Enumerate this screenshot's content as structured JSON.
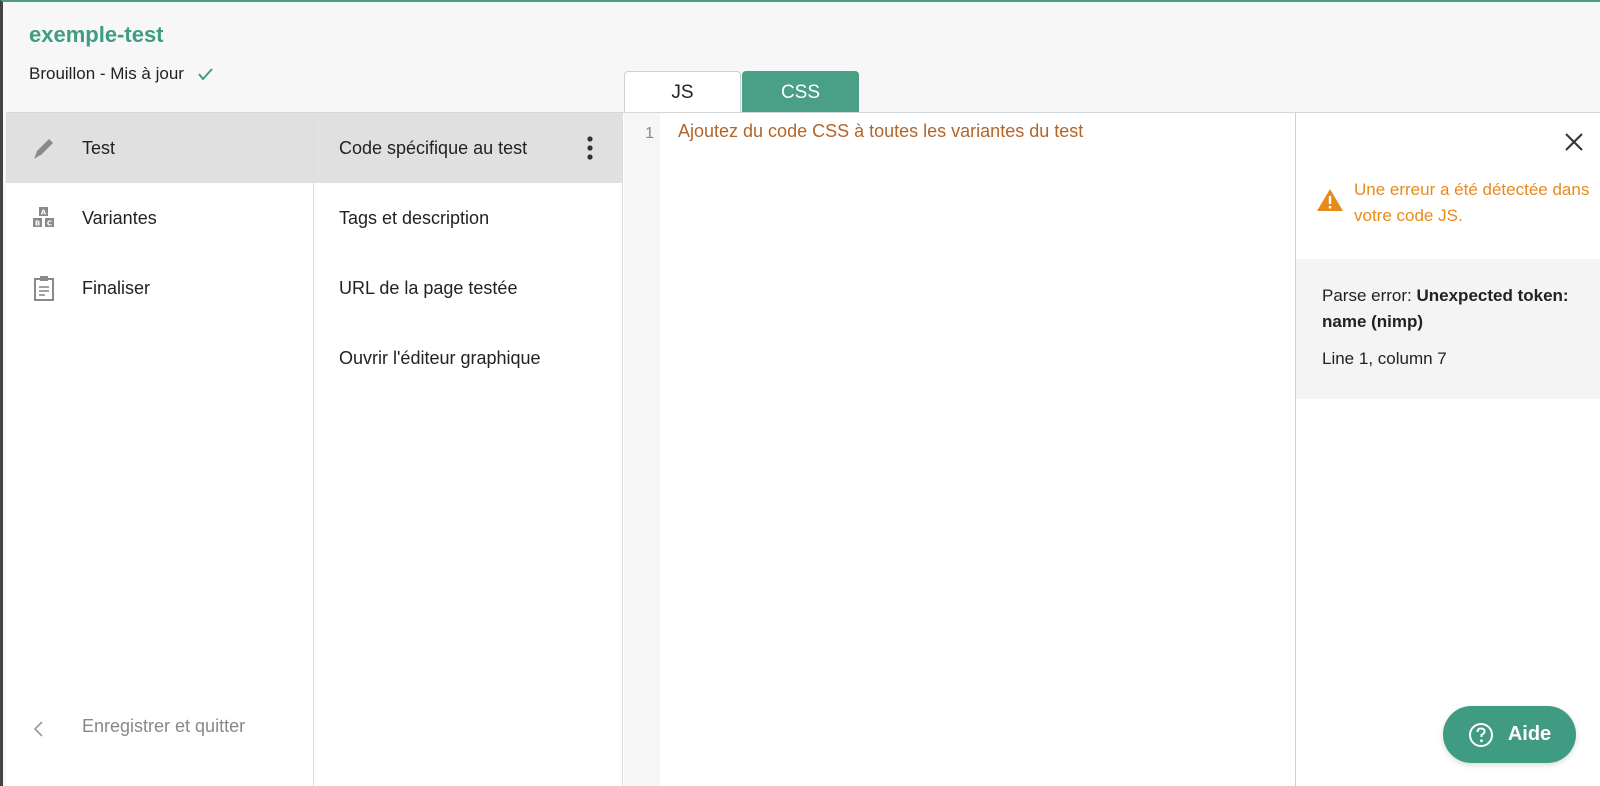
{
  "header": {
    "title": "exemple-test",
    "status": "Brouillon - Mis à jour",
    "status_icon": "check-icon"
  },
  "tabs": [
    {
      "label": "JS",
      "active": false
    },
    {
      "label": "CSS",
      "active": true
    }
  ],
  "sidebar": {
    "items": [
      {
        "label": "Test",
        "icon": "pencil-icon",
        "active": true
      },
      {
        "label": "Variantes",
        "icon": "abc-blocks-icon",
        "active": false
      },
      {
        "label": "Finaliser",
        "icon": "clipboard-icon",
        "active": false
      }
    ],
    "save_quit": "Enregistrer et quitter"
  },
  "submenu": {
    "items": [
      {
        "label": "Code spécifique au test",
        "active": true
      },
      {
        "label": "Tags et description",
        "active": false
      },
      {
        "label": "URL de la page testée",
        "active": false
      },
      {
        "label": "Ouvrir l'éditeur graphique",
        "active": false
      }
    ]
  },
  "editor": {
    "line_number": "1",
    "placeholder": "Ajoutez du code CSS à toutes les variantes du test"
  },
  "error_panel": {
    "warning": "Une erreur a été détectée dans votre code JS.",
    "error_prefix": "Parse error: ",
    "error_detail": "Unexpected token: name (nimp)",
    "error_location": "Line 1, column 7"
  },
  "help_button": {
    "label": "Aide"
  },
  "colors": {
    "accent": "#3f9c82",
    "warning": "#e88a1a",
    "code_placeholder": "#b1652a"
  }
}
